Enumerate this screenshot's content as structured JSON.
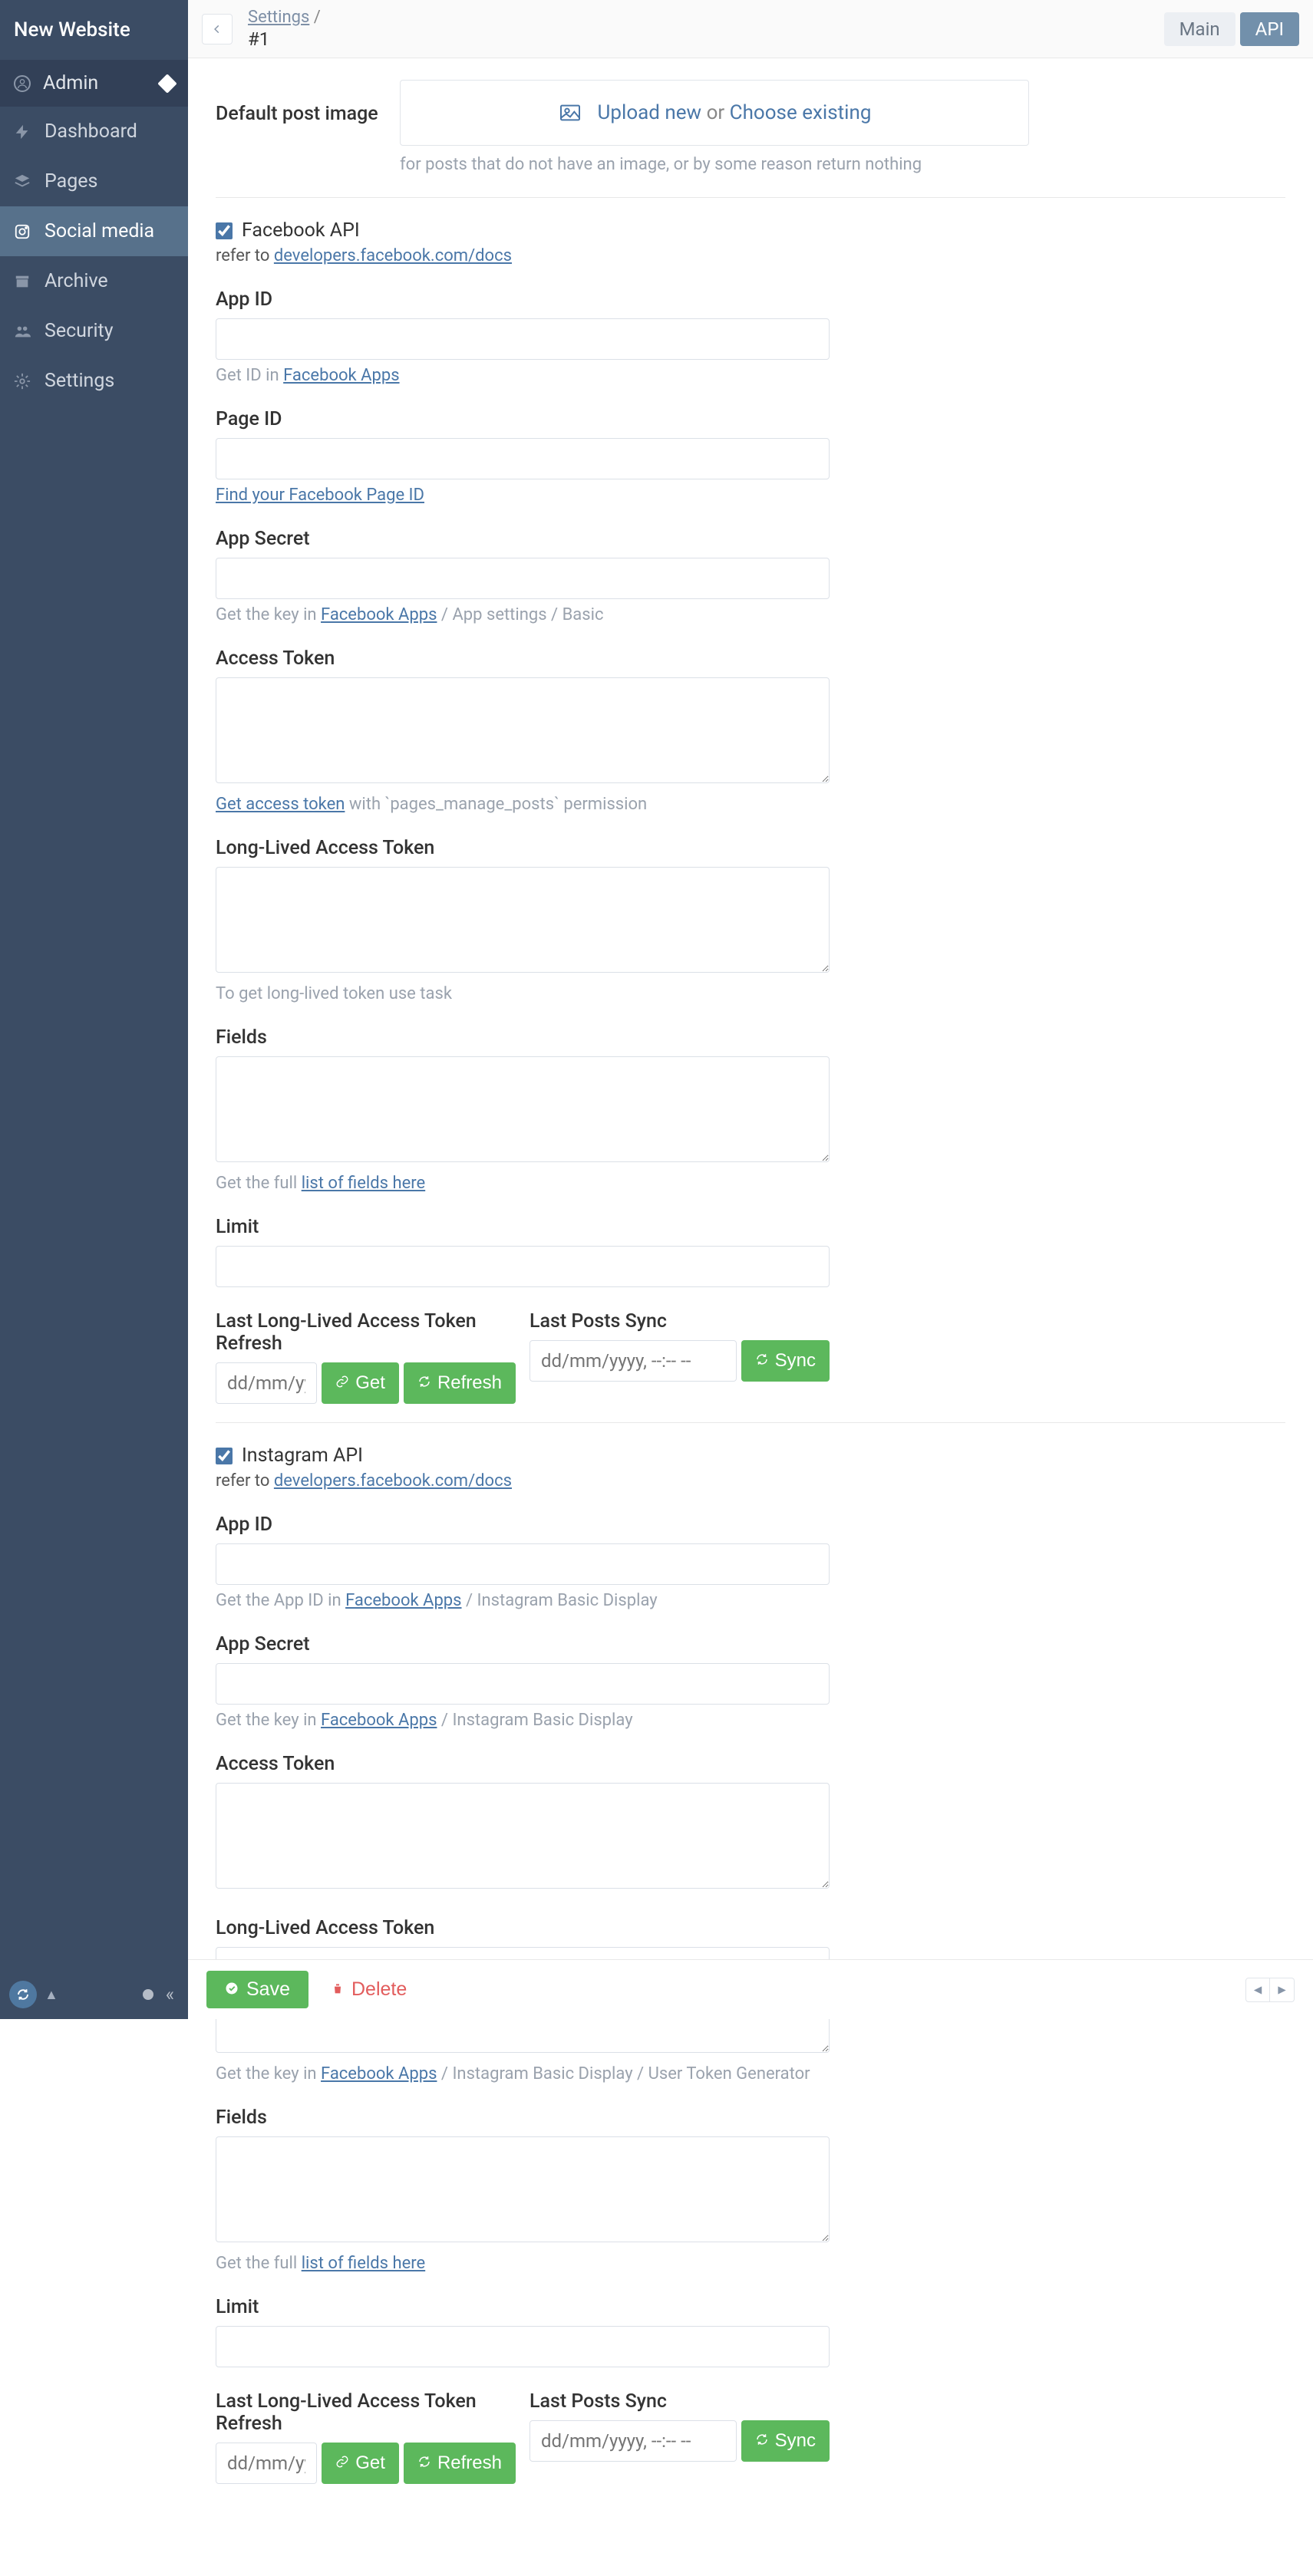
{
  "brand": "New Website",
  "user": {
    "name": "Admin"
  },
  "nav": {
    "dashboard": "Dashboard",
    "pages": "Pages",
    "social": "Social media",
    "archive": "Archive",
    "security": "Security",
    "settings": "Settings"
  },
  "breadcrumb": {
    "parent": "Settings",
    "sep": " /",
    "current": "#1"
  },
  "tabs": {
    "main": "Main",
    "api": "API"
  },
  "default_image": {
    "label": "Default post image",
    "upload": "Upload new",
    "or": "or",
    "choose": "Choose existing",
    "hint": "for posts that do not have an image, or by some reason return nothing"
  },
  "fb": {
    "title": "Facebook API",
    "refer_pre": "refer to ",
    "refer_link": "developers.facebook.com/docs",
    "app_id": {
      "label": "App ID",
      "hint_pre": "Get ID in ",
      "hint_link": "Facebook Apps"
    },
    "page_id": {
      "label": "Page ID",
      "hint_link": "Find your Facebook Page ID"
    },
    "app_secret": {
      "label": "App Secret",
      "hint_pre": "Get the key in ",
      "hint_link": "Facebook Apps",
      "hint_post": " / App settings / Basic"
    },
    "access_token": {
      "label": "Access Token",
      "hint_link": "Get access token",
      "hint_post": " with `pages_manage_posts` permission"
    },
    "long_token": {
      "label": "Long-Lived Access Token",
      "hint": "To get long-lived token use task"
    },
    "fields": {
      "label": "Fields",
      "hint_pre": "Get the full ",
      "hint_link": "list of fields here"
    },
    "limit": {
      "label": "Limit"
    },
    "token_refresh": {
      "label": "Last Long-Lived Access Token Refresh",
      "ph": "dd/mm/yyyy, --:-- --",
      "get": "Get",
      "refresh": "Refresh"
    },
    "posts_sync": {
      "label": "Last Posts Sync",
      "ph": "dd/mm/yyyy, --:-- --",
      "sync": "Sync"
    }
  },
  "ig": {
    "title": "Instagram API",
    "refer_pre": "refer to ",
    "refer_link": "developers.facebook.com/docs",
    "app_id": {
      "label": "App ID",
      "hint_pre": "Get the App ID in ",
      "hint_link": "Facebook Apps",
      "hint_post": " / Instagram Basic Display"
    },
    "app_secret": {
      "label": "App Secret",
      "hint_pre": "Get the key in ",
      "hint_link": "Facebook Apps",
      "hint_post": " / Instagram Basic Display"
    },
    "access_token": {
      "label": "Access Token"
    },
    "long_token": {
      "label": "Long-Lived Access Token",
      "hint_pre": "Get the key in ",
      "hint_link": "Facebook Apps",
      "hint_post": " / Instagram Basic Display / User Token Generator"
    },
    "fields": {
      "label": "Fields",
      "hint_pre": "Get the full ",
      "hint_link": "list of fields here"
    },
    "limit": {
      "label": "Limit"
    },
    "token_refresh": {
      "label": "Last Long-Lived Access Token Refresh",
      "ph": "dd/mm/yyyy, --:-- --",
      "get": "Get",
      "refresh": "Refresh"
    },
    "posts_sync": {
      "label": "Last Posts Sync",
      "ph": "dd/mm/yyyy, --:-- --",
      "sync": "Sync"
    }
  },
  "footer": {
    "save": "Save",
    "delete": "Delete"
  }
}
